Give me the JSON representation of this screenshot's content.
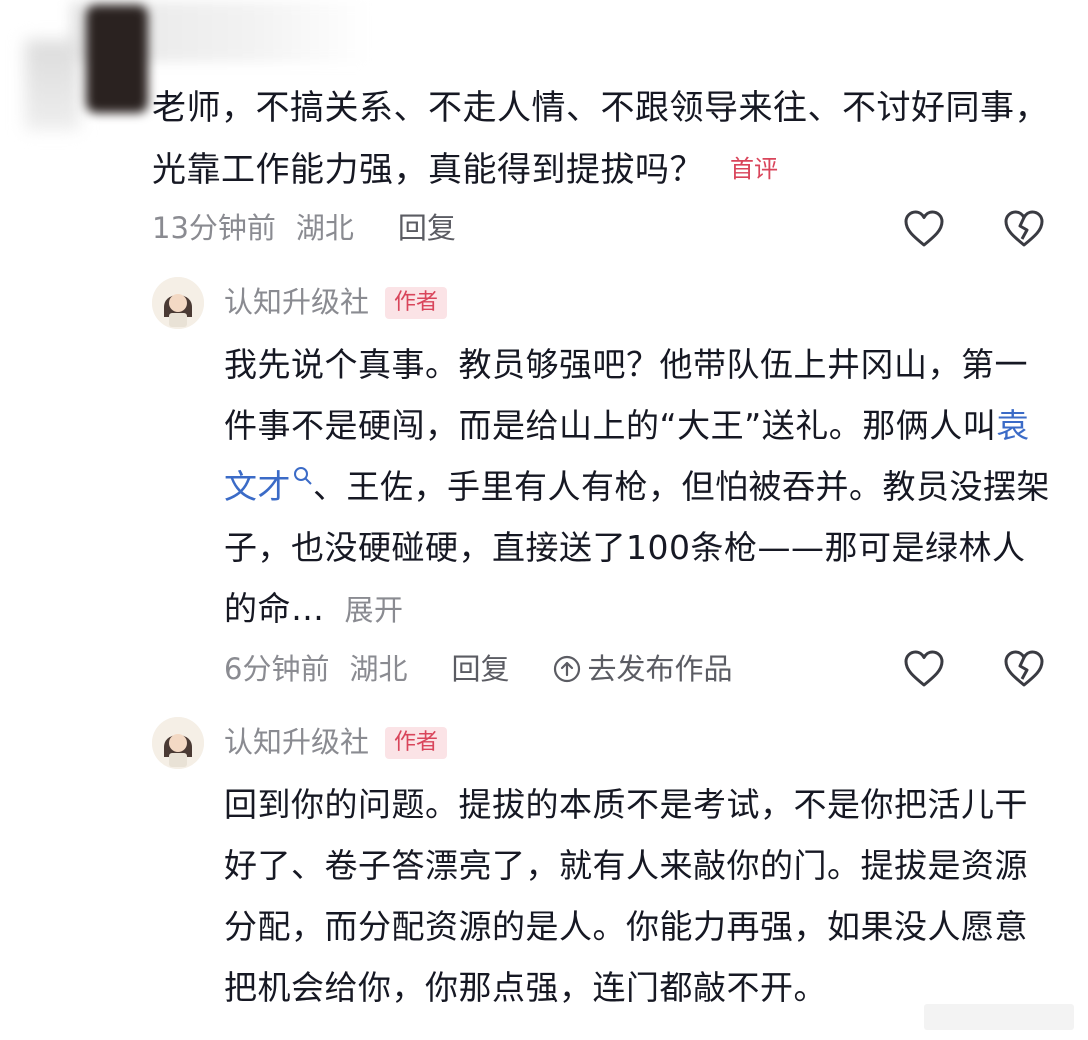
{
  "question": {
    "text": "老师，不搞关系、不走人情、不跟领导来往、不讨好同事，光靠工作能力强，真能得到提拔吗？",
    "badge": "首评",
    "time": "13分钟前",
    "location": "湖北",
    "reply_label": "回复"
  },
  "replies": [
    {
      "author": "认知升级社",
      "author_badge": "作者",
      "text_before_link": "我先说个真事。教员够强吧？他带队伍上井冈山，第一件事不是硬闯，而是给山上的“大王”送礼。那俩人叫",
      "link_text": "袁文才",
      "text_after_link": "、王佐，手里有人有枪，但怕被吞并。教员没摆架子，也没硬碰硬，直接送了100条枪——那可是绿林人的命…",
      "expand_label": "展开",
      "time": "6分钟前",
      "location": "湖北",
      "reply_label": "回复",
      "publish_label": "去发布作品"
    },
    {
      "author": "认知升级社",
      "author_badge": "作者",
      "text": "回到你的问题。提拔的本质不是考试，不是你把活儿干好了、卷子答漂亮了，就有人来敲你的门。提拔是资源分配，而分配资源的是人。你能力再强，如果没人愿意把机会给你，你那点强，连门都敲不开。"
    }
  ],
  "colors": {
    "badge_red": "#d9455b",
    "badge_bg": "#fbe3e6",
    "link_blue": "#3b6bc7",
    "meta_gray": "#8a8b91"
  },
  "icons": [
    "heart-icon",
    "broken-heart-icon",
    "search-icon",
    "upload-icon"
  ]
}
